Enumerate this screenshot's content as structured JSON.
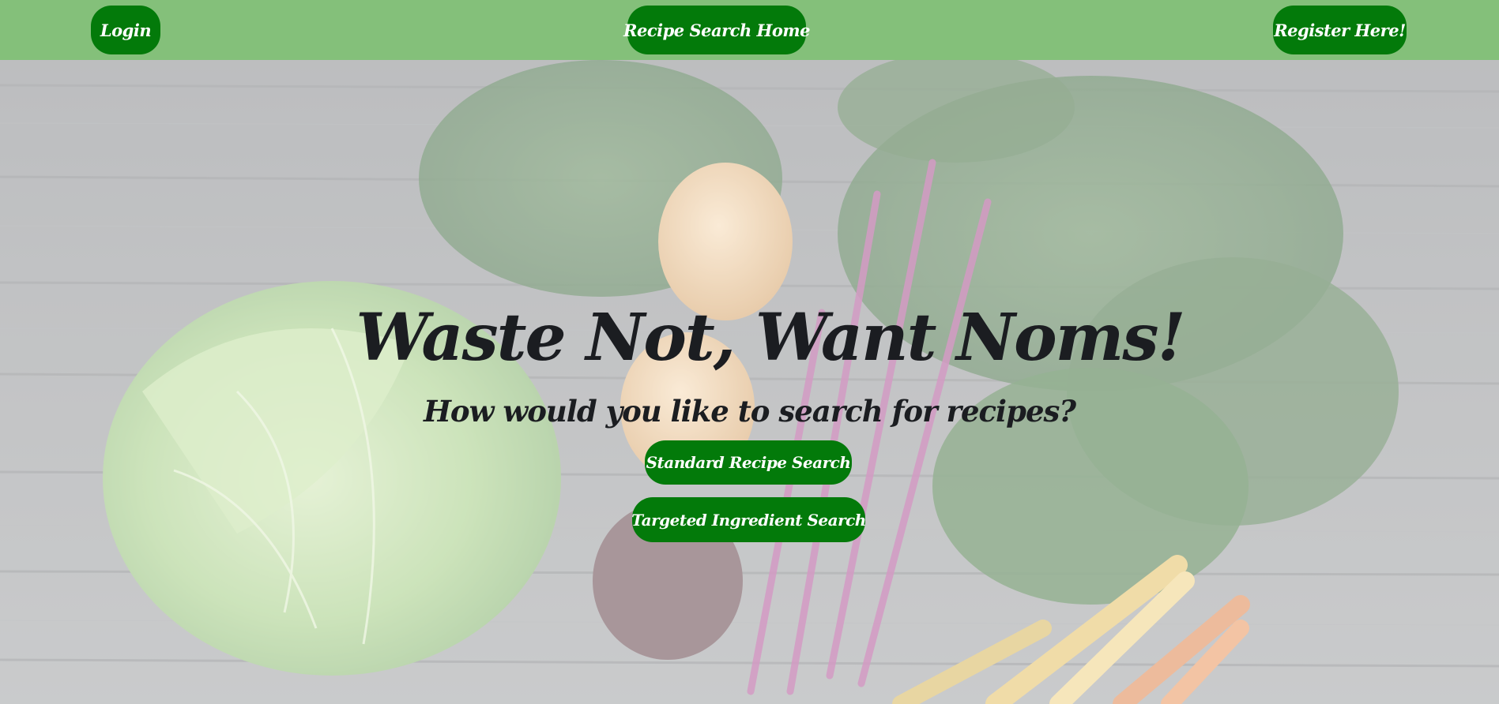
{
  "nav": {
    "login_label": "Login",
    "home_label": "Recipe Search Home",
    "register_label": "Register Here!"
  },
  "hero": {
    "title": "Waste Not, Want Noms!",
    "subtitle": "How would you like to search for recipes?"
  },
  "search_options": {
    "standard_label": "Standard Recipe Search",
    "targeted_label": "Targeted Ingredient Search"
  },
  "colors": {
    "navbar": "#84c07a",
    "button": "#037a0a",
    "button_text": "#ffffff",
    "heading_text": "#1b1d21"
  }
}
